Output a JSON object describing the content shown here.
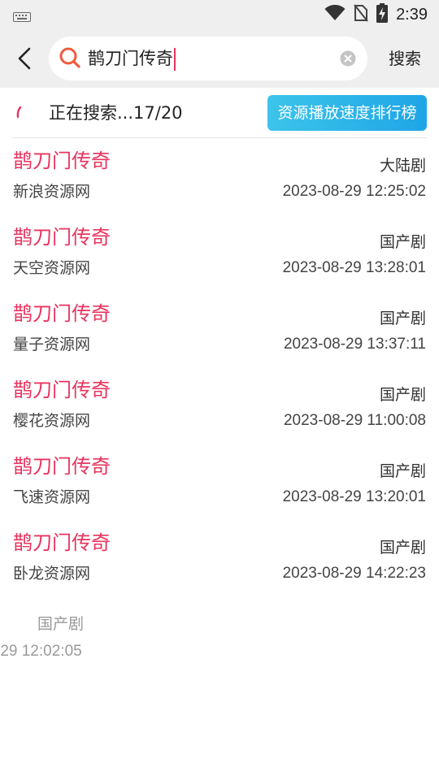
{
  "status_bar": {
    "time": "2:39",
    "icons": [
      "keyboard-icon",
      "wifi-icon",
      "no-sim-icon",
      "battery-charging-icon"
    ]
  },
  "search": {
    "back_icon": "chevron-left-icon",
    "search_icon": "search-icon",
    "query": "鹊刀门传奇",
    "clear_icon": "clear-icon",
    "button_label": "搜索"
  },
  "progress": {
    "text": "正在搜索...17/20",
    "rank_button_label": "资源播放速度排行榜"
  },
  "colors": {
    "title": "#e8345f",
    "accent_gradient_start": "#3cc4ea",
    "accent_gradient_end": "#1fa5e6",
    "bar_background": "#efefef"
  },
  "results": [
    {
      "title": "鹊刀门传奇",
      "genre": "大陆剧",
      "source": "新浪资源网",
      "time": "2023-08-29 12:25:02"
    },
    {
      "title": "鹊刀门传奇",
      "genre": "国产剧",
      "source": "天空资源网",
      "time": "2023-08-29 13:28:01"
    },
    {
      "title": "鹊刀门传奇",
      "genre": "国产剧",
      "source": "量子资源网",
      "time": "2023-08-29 13:37:11"
    },
    {
      "title": "鹊刀门传奇",
      "genre": "国产剧",
      "source": "樱花资源网",
      "time": "2023-08-29 11:00:08"
    },
    {
      "title": "鹊刀门传奇",
      "genre": "国产剧",
      "source": "飞速资源网",
      "time": "2023-08-29 13:20:01"
    },
    {
      "title": "鹊刀门传奇",
      "genre": "国产剧",
      "source": "卧龙资源网",
      "time": "2023-08-29 14:22:23"
    }
  ],
  "partial_item": {
    "genre": "国产剧",
    "time": "-29 12:02:05"
  }
}
